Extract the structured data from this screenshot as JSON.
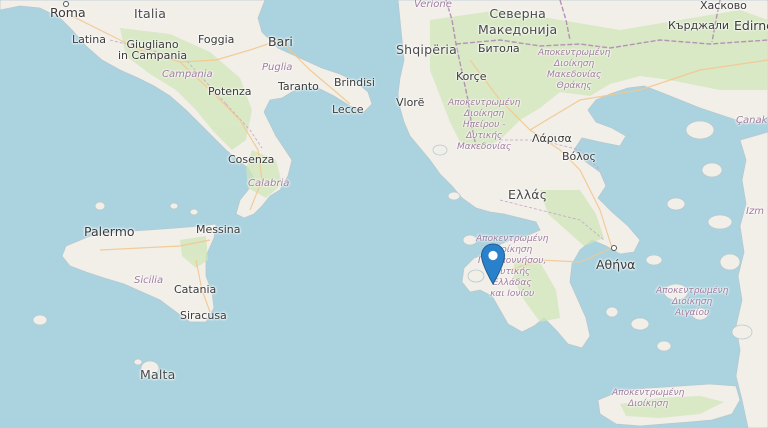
{
  "map": {
    "water_color": "#aad3df",
    "land_color": "#f2efe9",
    "green_color": "#d0e5b8",
    "border_color": "#b493b5",
    "marker_color": "#2a81cb"
  },
  "countries": {
    "italy": "Italia",
    "albania": "Shqipëria",
    "north_macedonia": "Северна\nМакедонија",
    "greece": "Ελλάς",
    "malta": "Malta"
  },
  "cities": {
    "roma": "Roma",
    "latina": "Latina",
    "giugliano": "Giugliano\nin Campania",
    "foggia": "Foggia",
    "bari": "Bari",
    "brindisi": "Brindisi",
    "taranto": "Taranto",
    "potenza": "Potenza",
    "lecce": "Lecce",
    "cosenza": "Cosenza",
    "messina": "Messina",
    "palermo": "Palermo",
    "catania": "Catania",
    "siracusa": "Siracusa",
    "vlore": "Vlorë",
    "korce": "Korçe",
    "bitola": "Битола",
    "larisa": "Λάρισα",
    "volos": "Βόλος",
    "athina": "Αθήνα",
    "kardzhali": "Кърджали",
    "edirne": "Edirne",
    "verione": "Verione",
    "kaskovo": "Хасково"
  },
  "regions": {
    "campania": "Campania",
    "puglia": "Puglia",
    "calabria": "Calabria",
    "sicilia": "Sicilia",
    "macedonia_thrace": "Αποκεντρωμένη\nΔιοίκηση\nΜακεδονίας\nΘράκης",
    "epirus": "Αποκεντρωμένη\nΔιοίκηση\nΗπείρου -\nΔυτικής\nΜακεδονίας",
    "peloponnese": "Αποκεντρωμένη\nΔιοίκηση\nΠελοποννήσου,\nΔυτικής\nΕλλάδας\nκαι Ιονίου",
    "aegean": "Αποκεντρωμένη\nΔιοίκηση\nΑιγαίου",
    "crete": "Αποκεντρωμένη\nΔιοίκηση",
    "canak": "Çanak",
    "izmir": "Izm"
  }
}
